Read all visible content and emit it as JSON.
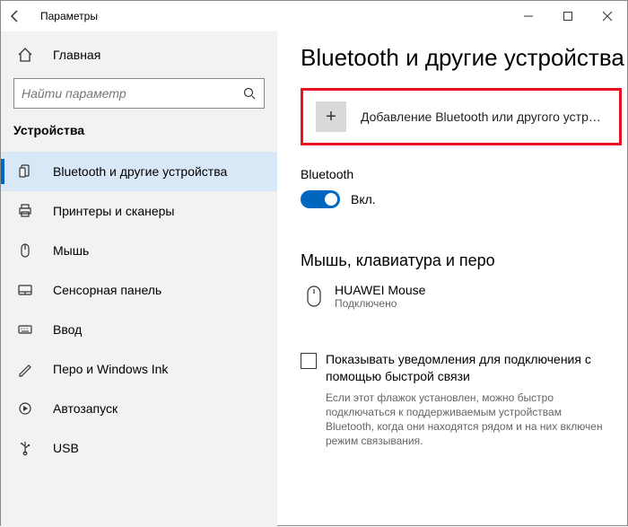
{
  "titlebar": {
    "title": "Параметры"
  },
  "sidebar": {
    "home": "Главная",
    "search_placeholder": "Найти параметр",
    "section": "Устройства",
    "items": [
      {
        "label": "Bluetooth и другие устройства"
      },
      {
        "label": "Принтеры и сканеры"
      },
      {
        "label": "Мышь"
      },
      {
        "label": "Сенсорная панель"
      },
      {
        "label": "Ввод"
      },
      {
        "label": "Перо и Windows Ink"
      },
      {
        "label": "Автозапуск"
      },
      {
        "label": "USB"
      }
    ]
  },
  "content": {
    "heading": "Bluetooth и другие устройства",
    "add_label": "Добавление Bluetooth или другого устройс...",
    "bt_label": "Bluetooth",
    "bt_state": "Вкл.",
    "group_heading": "Мышь, клавиатура и перо",
    "device": {
      "name": "HUAWEI  Mouse",
      "status": "Подключено"
    },
    "checkbox_label": "Показывать уведомления для подключения с помощью быстрой связи",
    "checkbox_hint": "Если этот флажок установлен, можно быстро подключаться к поддерживаемым устройствам Bluetooth, когда они находятся рядом и на них включен режим связывания."
  }
}
